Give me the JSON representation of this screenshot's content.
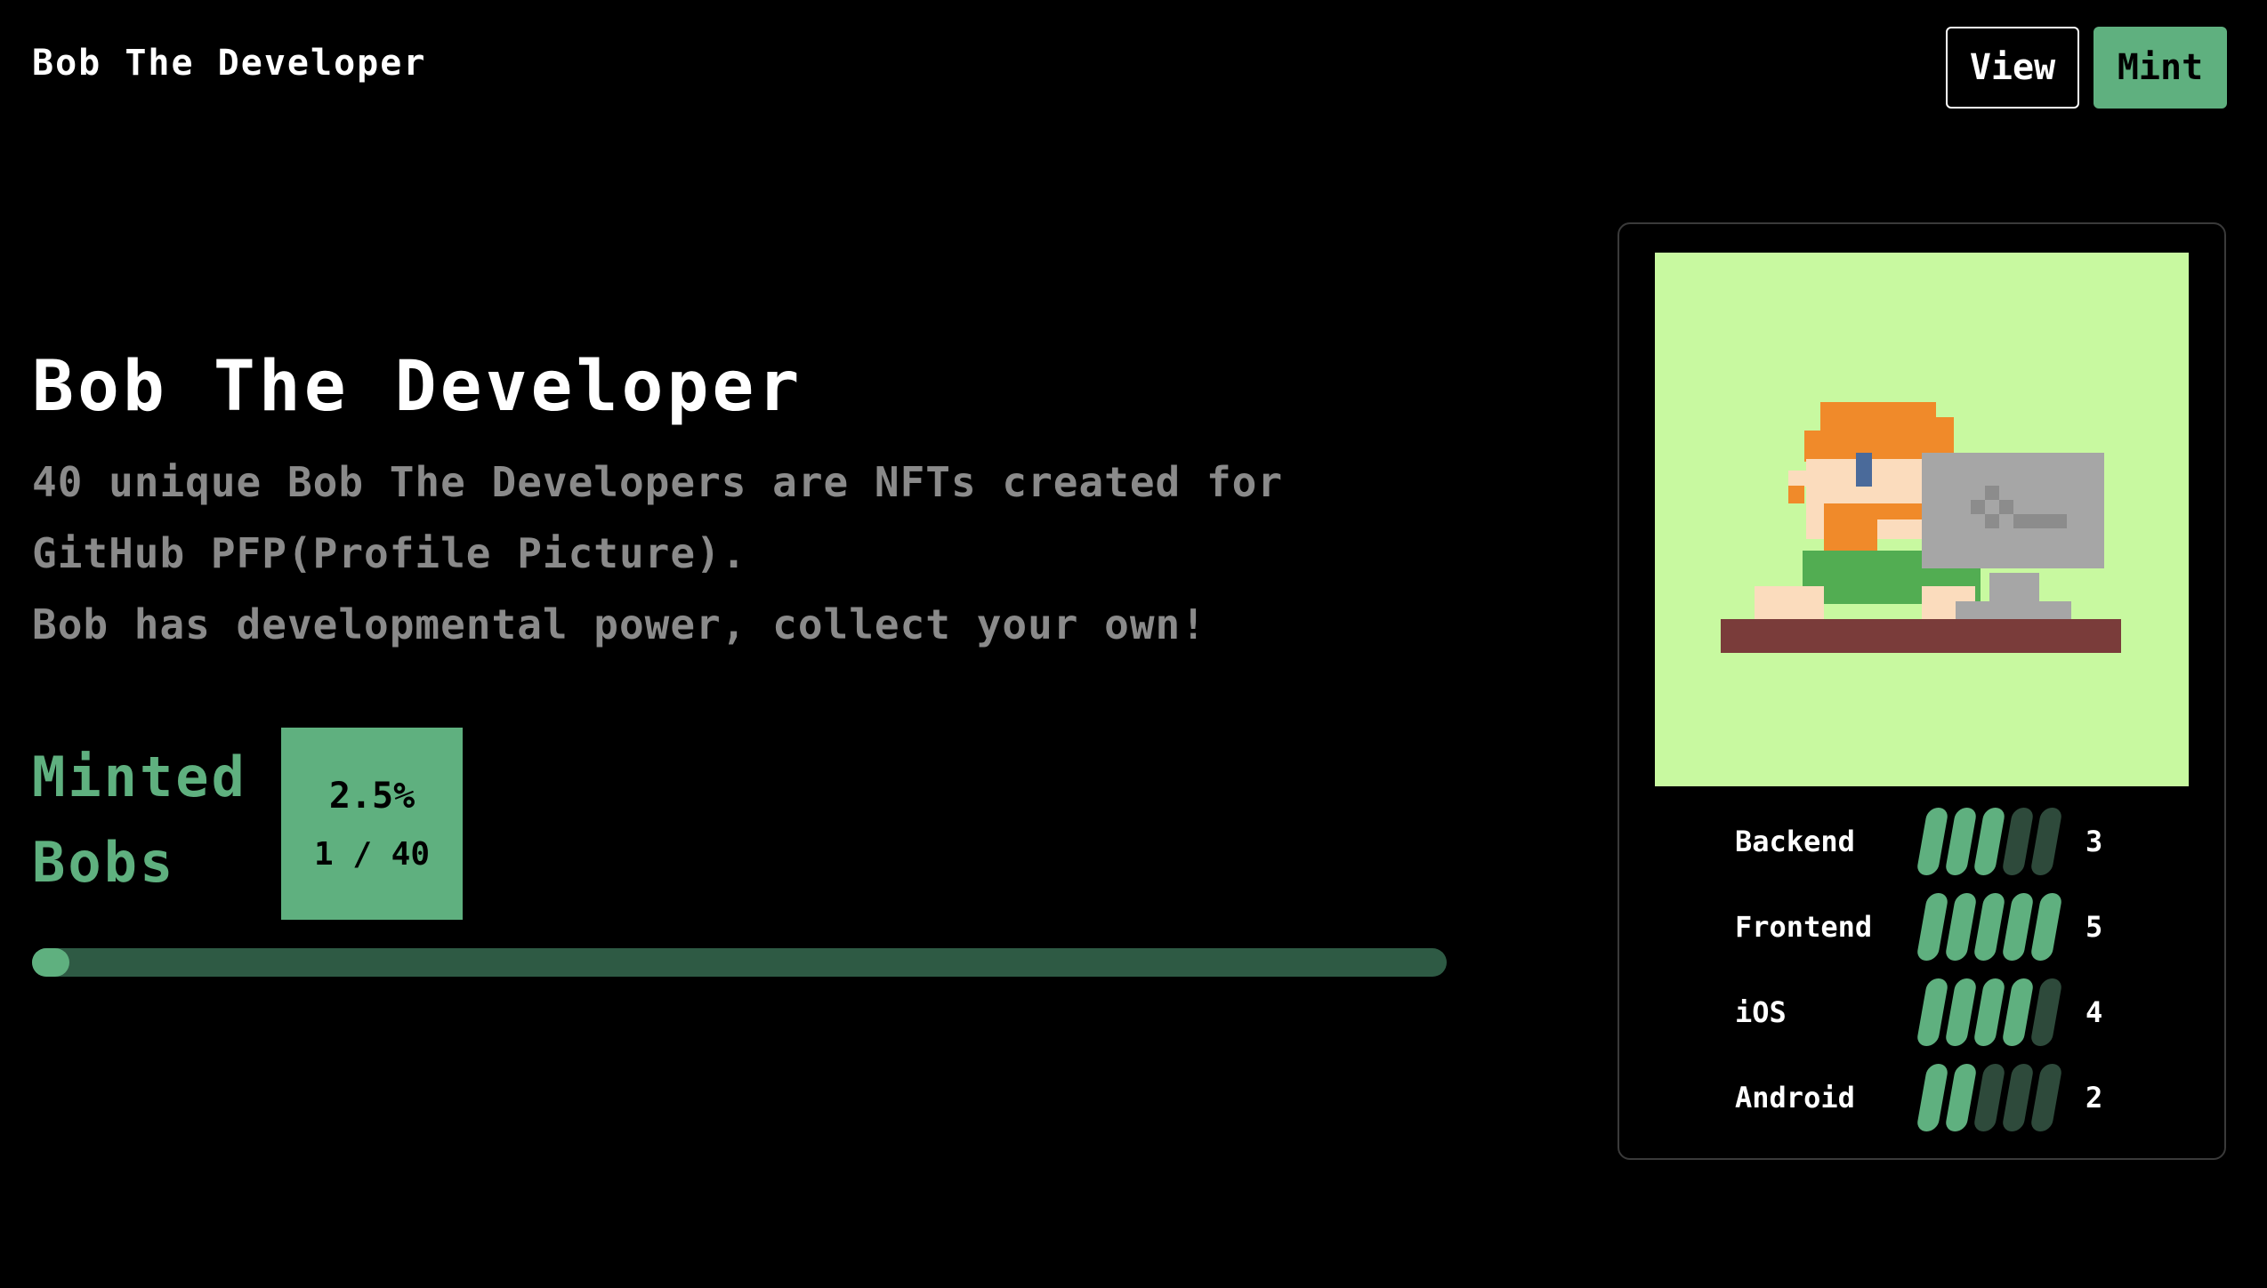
{
  "header": {
    "brand": "Bob The Developer",
    "view_label": "View",
    "mint_label": "Mint"
  },
  "hero": {
    "title": "Bob The Developer",
    "desc_line1": "40 unique Bob The Developers are NFTs created for GitHub PFP(Profile Picture).",
    "desc_line2": "Bob has developmental power, collect your own!"
  },
  "minted": {
    "label_line1": "Minted",
    "label_line2": "Bobs",
    "percent_text": "2.5%",
    "count_text": "1 / 40",
    "progress_fraction": 0.025
  },
  "card": {
    "stats": [
      {
        "label": "Backend",
        "value": "3",
        "level": 3,
        "max": 5
      },
      {
        "label": "Frontend",
        "value": "5",
        "level": 5,
        "max": 5
      },
      {
        "label": "iOS",
        "value": "4",
        "level": 4,
        "max": 5
      },
      {
        "label": "Android",
        "value": "2",
        "level": 2,
        "max": 5
      }
    ]
  },
  "colors": {
    "accent": "#5fb07f",
    "accent_dark": "#2e5a44",
    "card_bg": "#c8f9a0"
  }
}
